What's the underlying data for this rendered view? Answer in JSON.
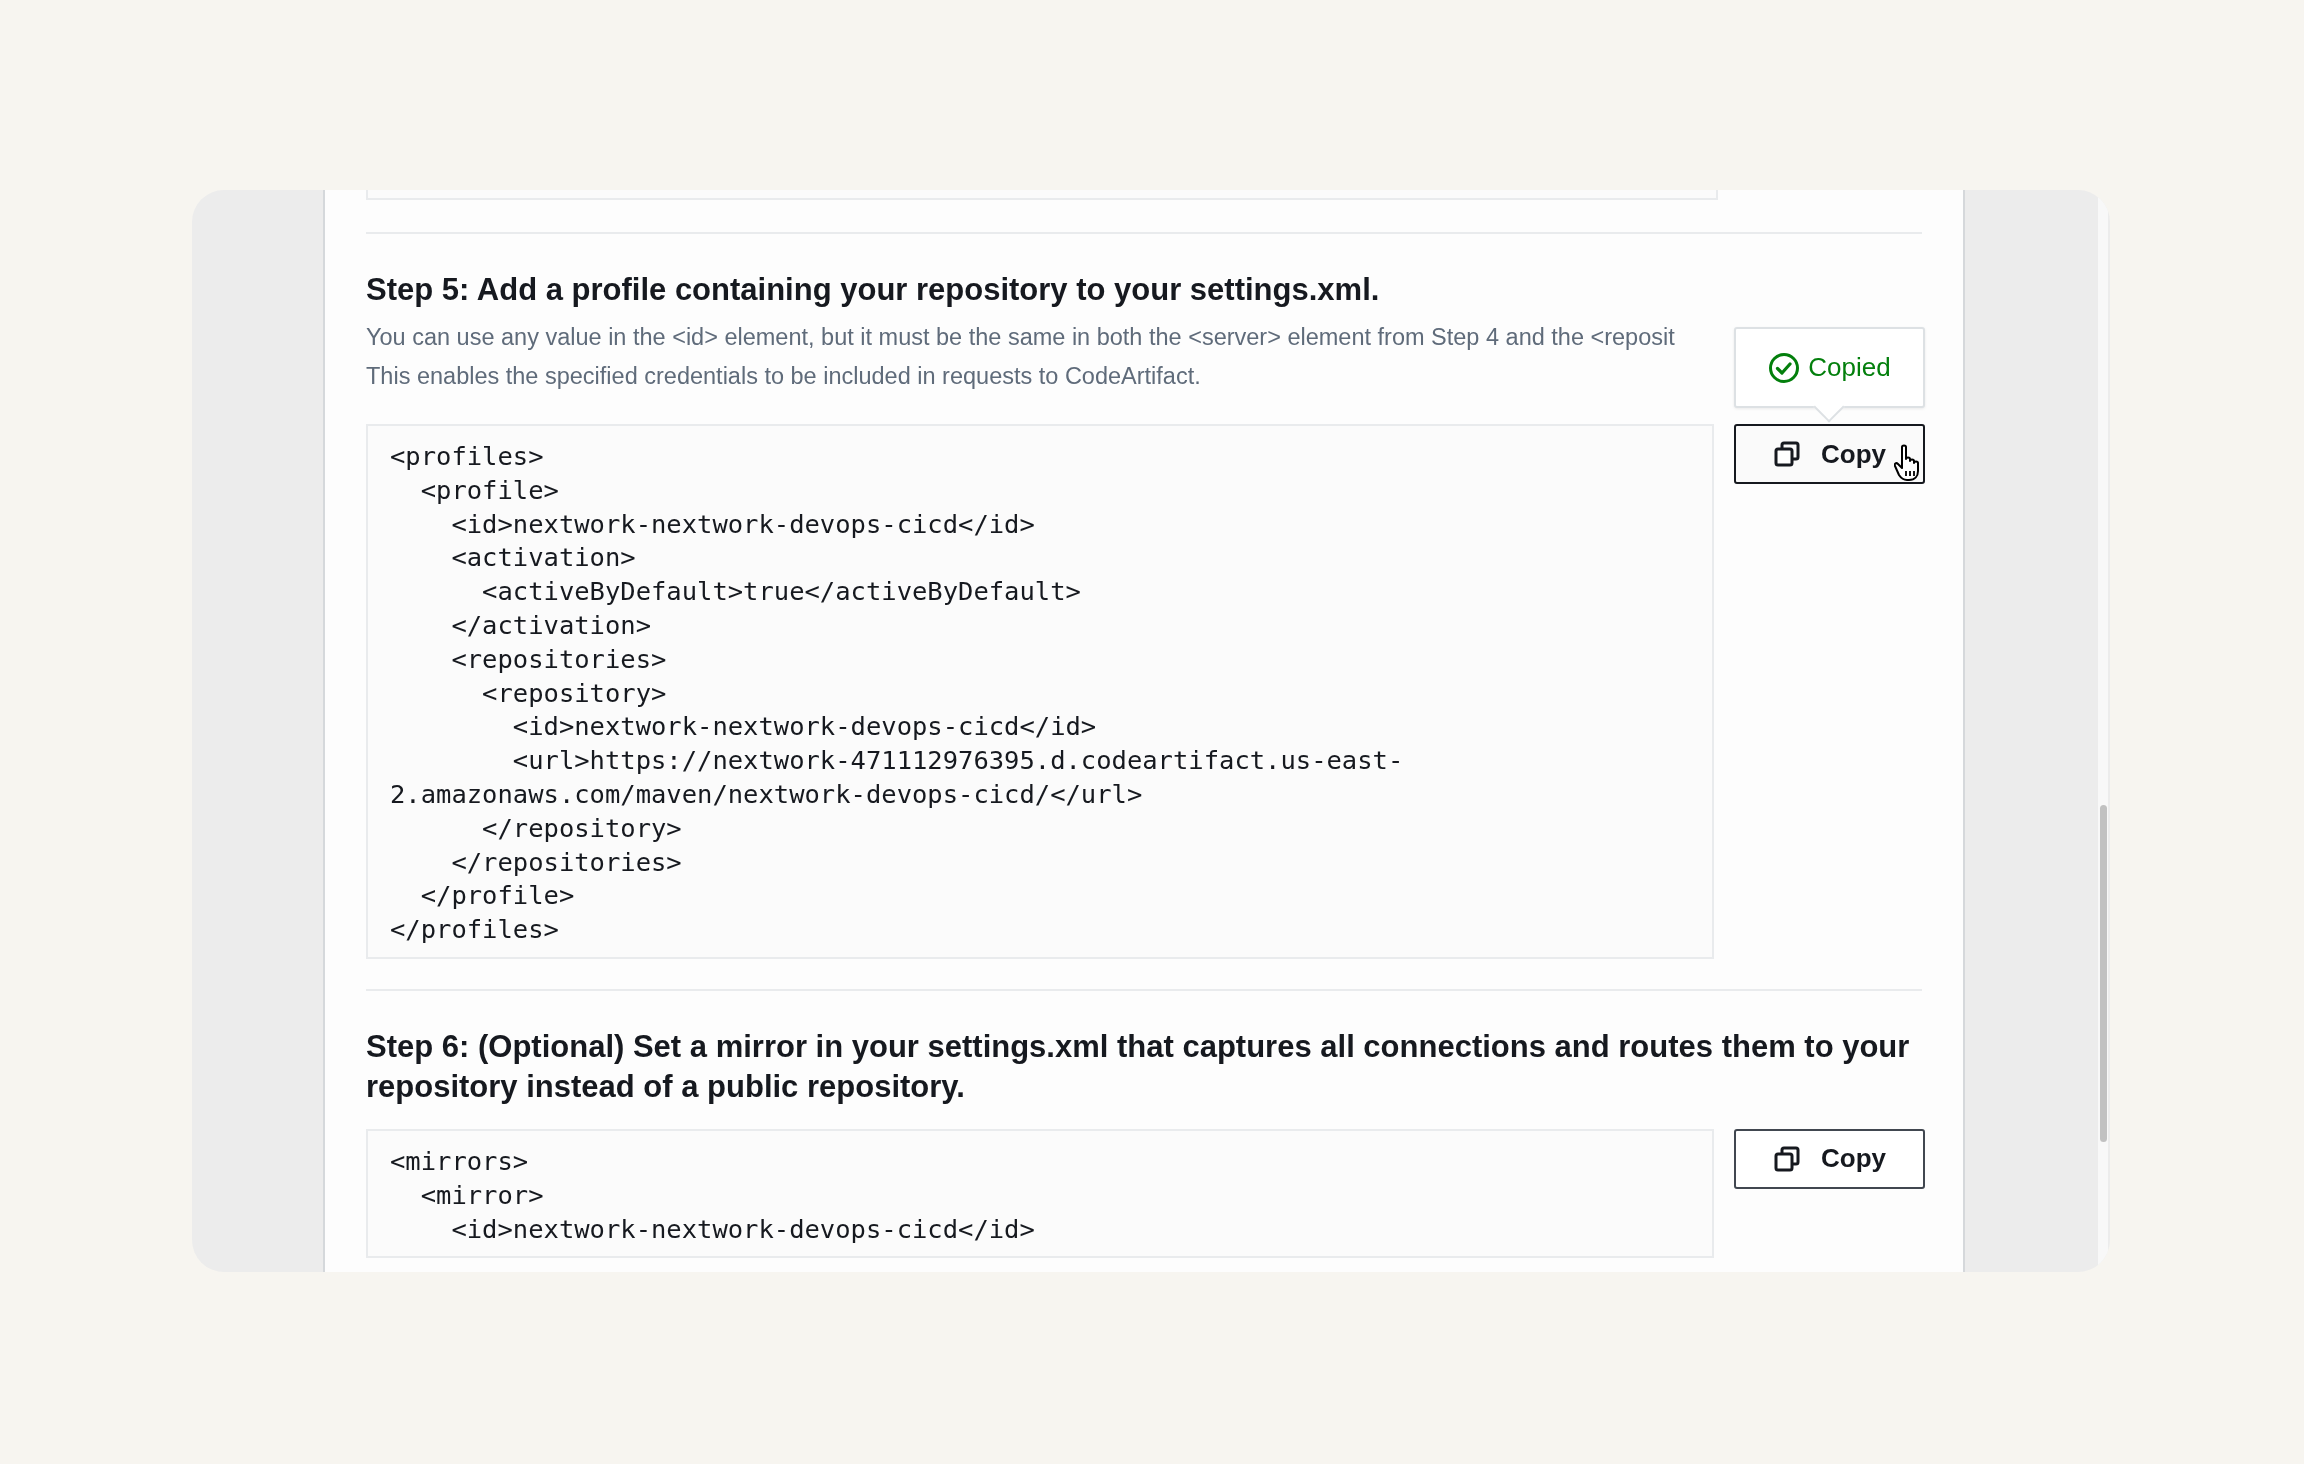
{
  "steps": [
    {
      "heading": "Step 5: Add a profile containing your repository to your settings.xml.",
      "description": [
        "You can use any value in the <id> element, but it must be the same in both the <server> element from Step 4 and the <reposit",
        "This enables the specified credentials to be included in requests to CodeArtifact."
      ],
      "code": [
        "<profiles>",
        "  <profile>",
        "    <id>nextwork-nextwork-devops-cicd</id>",
        "    <activation>",
        "      <activeByDefault>true</activeByDefault>",
        "    </activation>",
        "    <repositories>",
        "      <repository>",
        "        <id>nextwork-nextwork-devops-cicd</id>",
        "        <url>https://nextwork-471112976395.d.codeartifact.us-east-",
        "2.amazonaws.com/maven/nextwork-devops-cicd/</url>",
        "      </repository>",
        "    </repositories>",
        "  </profile>",
        "</profiles>"
      ],
      "copy_button": {
        "label": "Copy",
        "hovered": true
      },
      "tooltip": {
        "text": "Copied"
      }
    },
    {
      "heading": "Step 6: (Optional) Set a mirror in your settings.xml that captures all connections and routes them to your repository instead of a public repository.",
      "code": [
        "<mirrors>",
        "  <mirror>",
        "    <id>nextwork-nextwork-devops-cicd</id>"
      ],
      "copy_button": {
        "label": "Copy",
        "hovered": false
      }
    }
  ]
}
